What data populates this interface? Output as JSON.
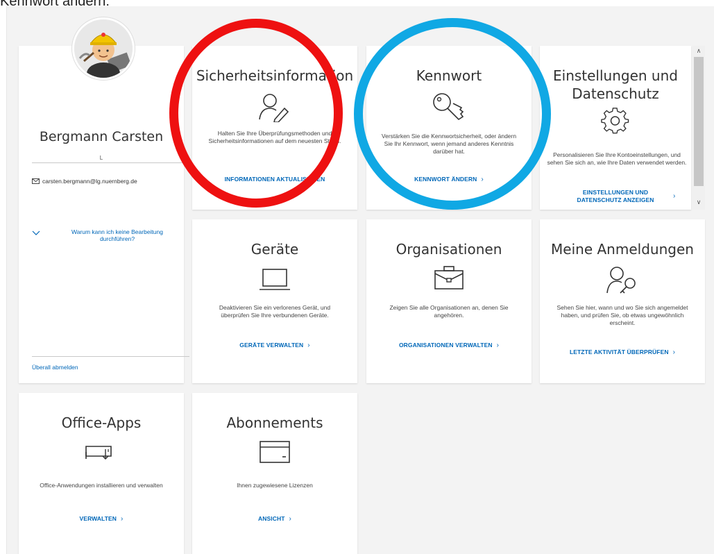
{
  "caption": "Kennwort ändern:",
  "profile": {
    "name": "Bergmann Carsten",
    "initial": "L",
    "email": "carsten.bergmann@lg.nuernberg.de",
    "why_link": "Warum kann ich keine Bearbeitung durchführen?",
    "signout": "Überall abmelden"
  },
  "cards": {
    "security": {
      "title": "Sicherheitsinformation",
      "desc": "Halten Sie Ihre Überprüfungsmethoden und Sicherheitsinformationen auf dem neuesten Stand.",
      "link": "INFORMATIONEN AKTUALISIEREN"
    },
    "password": {
      "title": "Kennwort",
      "desc": "Verstärken Sie die Kennwortsicherheit, oder ändern Sie Ihr Kennwort, wenn jemand anderes Kenntnis darüber hat.",
      "link": "KENNWORT ÄNDERN"
    },
    "privacy": {
      "title_line1": "Einstellungen und",
      "title_line2": "Datenschutz",
      "desc": "Personalisieren Sie Ihre Kontoeinstellungen, und sehen Sie sich an, wie Ihre Daten verwendet werden.",
      "link_line1": "EINSTELLUNGEN UND",
      "link_line2": "DATENSCHUTZ ANZEIGEN"
    },
    "devices": {
      "title": "Geräte",
      "desc": "Deaktivieren Sie ein verlorenes Gerät, und überprüfen Sie Ihre verbundenen Geräte.",
      "link": "GERÄTE VERWALTEN"
    },
    "organizations": {
      "title": "Organisationen",
      "desc": "Zeigen Sie alle Organisationen an, denen Sie angehören.",
      "link": "ORGANISATIONEN VERWALTEN"
    },
    "signins": {
      "title": "Meine Anmeldungen",
      "desc": "Sehen Sie hier, wann und wo Sie sich angemeldet haben, und prüfen Sie, ob etwas ungewöhnlich erscheint.",
      "link": "LETZTE AKTIVITÄT ÜBERPRÜFEN"
    },
    "office": {
      "title": "Office-Apps",
      "desc": "Office-Anwendungen installieren und verwalten",
      "link": "VERWALTEN"
    },
    "subscriptions": {
      "title": "Abonnements",
      "desc": "Ihnen zugewiesene Lizenzen",
      "link": "ANSICHT"
    }
  },
  "icons": {
    "chevron": "›",
    "scroll_up": "∧",
    "scroll_down": "∨"
  },
  "colors": {
    "link": "#0067b8",
    "annotation_red": "#ee1111",
    "annotation_blue": "#10a8e4"
  }
}
